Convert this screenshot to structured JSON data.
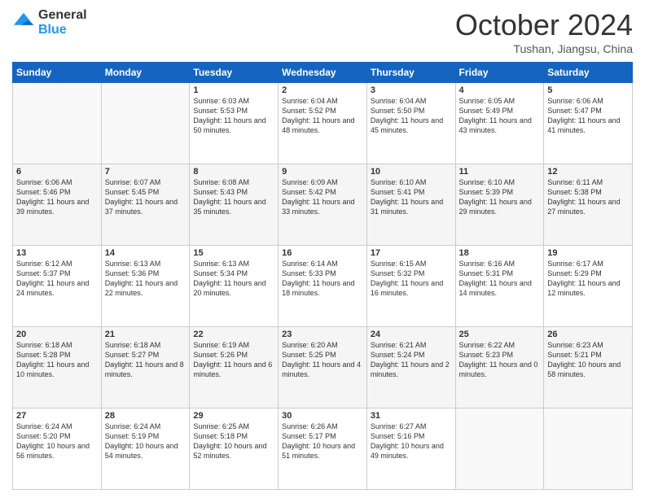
{
  "header": {
    "logo_general": "General",
    "logo_blue": "Blue",
    "month_title": "October 2024",
    "subtitle": "Tushan, Jiangsu, China"
  },
  "days_of_week": [
    "Sunday",
    "Monday",
    "Tuesday",
    "Wednesday",
    "Thursday",
    "Friday",
    "Saturday"
  ],
  "weeks": [
    [
      {
        "num": "",
        "sunrise": "",
        "sunset": "",
        "daylight": ""
      },
      {
        "num": "",
        "sunrise": "",
        "sunset": "",
        "daylight": ""
      },
      {
        "num": "1",
        "sunrise": "Sunrise: 6:03 AM",
        "sunset": "Sunset: 5:53 PM",
        "daylight": "Daylight: 11 hours and 50 minutes."
      },
      {
        "num": "2",
        "sunrise": "Sunrise: 6:04 AM",
        "sunset": "Sunset: 5:52 PM",
        "daylight": "Daylight: 11 hours and 48 minutes."
      },
      {
        "num": "3",
        "sunrise": "Sunrise: 6:04 AM",
        "sunset": "Sunset: 5:50 PM",
        "daylight": "Daylight: 11 hours and 45 minutes."
      },
      {
        "num": "4",
        "sunrise": "Sunrise: 6:05 AM",
        "sunset": "Sunset: 5:49 PM",
        "daylight": "Daylight: 11 hours and 43 minutes."
      },
      {
        "num": "5",
        "sunrise": "Sunrise: 6:06 AM",
        "sunset": "Sunset: 5:47 PM",
        "daylight": "Daylight: 11 hours and 41 minutes."
      }
    ],
    [
      {
        "num": "6",
        "sunrise": "Sunrise: 6:06 AM",
        "sunset": "Sunset: 5:46 PM",
        "daylight": "Daylight: 11 hours and 39 minutes."
      },
      {
        "num": "7",
        "sunrise": "Sunrise: 6:07 AM",
        "sunset": "Sunset: 5:45 PM",
        "daylight": "Daylight: 11 hours and 37 minutes."
      },
      {
        "num": "8",
        "sunrise": "Sunrise: 6:08 AM",
        "sunset": "Sunset: 5:43 PM",
        "daylight": "Daylight: 11 hours and 35 minutes."
      },
      {
        "num": "9",
        "sunrise": "Sunrise: 6:09 AM",
        "sunset": "Sunset: 5:42 PM",
        "daylight": "Daylight: 11 hours and 33 minutes."
      },
      {
        "num": "10",
        "sunrise": "Sunrise: 6:10 AM",
        "sunset": "Sunset: 5:41 PM",
        "daylight": "Daylight: 11 hours and 31 minutes."
      },
      {
        "num": "11",
        "sunrise": "Sunrise: 6:10 AM",
        "sunset": "Sunset: 5:39 PM",
        "daylight": "Daylight: 11 hours and 29 minutes."
      },
      {
        "num": "12",
        "sunrise": "Sunrise: 6:11 AM",
        "sunset": "Sunset: 5:38 PM",
        "daylight": "Daylight: 11 hours and 27 minutes."
      }
    ],
    [
      {
        "num": "13",
        "sunrise": "Sunrise: 6:12 AM",
        "sunset": "Sunset: 5:37 PM",
        "daylight": "Daylight: 11 hours and 24 minutes."
      },
      {
        "num": "14",
        "sunrise": "Sunrise: 6:13 AM",
        "sunset": "Sunset: 5:36 PM",
        "daylight": "Daylight: 11 hours and 22 minutes."
      },
      {
        "num": "15",
        "sunrise": "Sunrise: 6:13 AM",
        "sunset": "Sunset: 5:34 PM",
        "daylight": "Daylight: 11 hours and 20 minutes."
      },
      {
        "num": "16",
        "sunrise": "Sunrise: 6:14 AM",
        "sunset": "Sunset: 5:33 PM",
        "daylight": "Daylight: 11 hours and 18 minutes."
      },
      {
        "num": "17",
        "sunrise": "Sunrise: 6:15 AM",
        "sunset": "Sunset: 5:32 PM",
        "daylight": "Daylight: 11 hours and 16 minutes."
      },
      {
        "num": "18",
        "sunrise": "Sunrise: 6:16 AM",
        "sunset": "Sunset: 5:31 PM",
        "daylight": "Daylight: 11 hours and 14 minutes."
      },
      {
        "num": "19",
        "sunrise": "Sunrise: 6:17 AM",
        "sunset": "Sunset: 5:29 PM",
        "daylight": "Daylight: 11 hours and 12 minutes."
      }
    ],
    [
      {
        "num": "20",
        "sunrise": "Sunrise: 6:18 AM",
        "sunset": "Sunset: 5:28 PM",
        "daylight": "Daylight: 11 hours and 10 minutes."
      },
      {
        "num": "21",
        "sunrise": "Sunrise: 6:18 AM",
        "sunset": "Sunset: 5:27 PM",
        "daylight": "Daylight: 11 hours and 8 minutes."
      },
      {
        "num": "22",
        "sunrise": "Sunrise: 6:19 AM",
        "sunset": "Sunset: 5:26 PM",
        "daylight": "Daylight: 11 hours and 6 minutes."
      },
      {
        "num": "23",
        "sunrise": "Sunrise: 6:20 AM",
        "sunset": "Sunset: 5:25 PM",
        "daylight": "Daylight: 11 hours and 4 minutes."
      },
      {
        "num": "24",
        "sunrise": "Sunrise: 6:21 AM",
        "sunset": "Sunset: 5:24 PM",
        "daylight": "Daylight: 11 hours and 2 minutes."
      },
      {
        "num": "25",
        "sunrise": "Sunrise: 6:22 AM",
        "sunset": "Sunset: 5:23 PM",
        "daylight": "Daylight: 11 hours and 0 minutes."
      },
      {
        "num": "26",
        "sunrise": "Sunrise: 6:23 AM",
        "sunset": "Sunset: 5:21 PM",
        "daylight": "Daylight: 10 hours and 58 minutes."
      }
    ],
    [
      {
        "num": "27",
        "sunrise": "Sunrise: 6:24 AM",
        "sunset": "Sunset: 5:20 PM",
        "daylight": "Daylight: 10 hours and 56 minutes."
      },
      {
        "num": "28",
        "sunrise": "Sunrise: 6:24 AM",
        "sunset": "Sunset: 5:19 PM",
        "daylight": "Daylight: 10 hours and 54 minutes."
      },
      {
        "num": "29",
        "sunrise": "Sunrise: 6:25 AM",
        "sunset": "Sunset: 5:18 PM",
        "daylight": "Daylight: 10 hours and 52 minutes."
      },
      {
        "num": "30",
        "sunrise": "Sunrise: 6:26 AM",
        "sunset": "Sunset: 5:17 PM",
        "daylight": "Daylight: 10 hours and 51 minutes."
      },
      {
        "num": "31",
        "sunrise": "Sunrise: 6:27 AM",
        "sunset": "Sunset: 5:16 PM",
        "daylight": "Daylight: 10 hours and 49 minutes."
      },
      {
        "num": "",
        "sunrise": "",
        "sunset": "",
        "daylight": ""
      },
      {
        "num": "",
        "sunrise": "",
        "sunset": "",
        "daylight": ""
      }
    ]
  ]
}
